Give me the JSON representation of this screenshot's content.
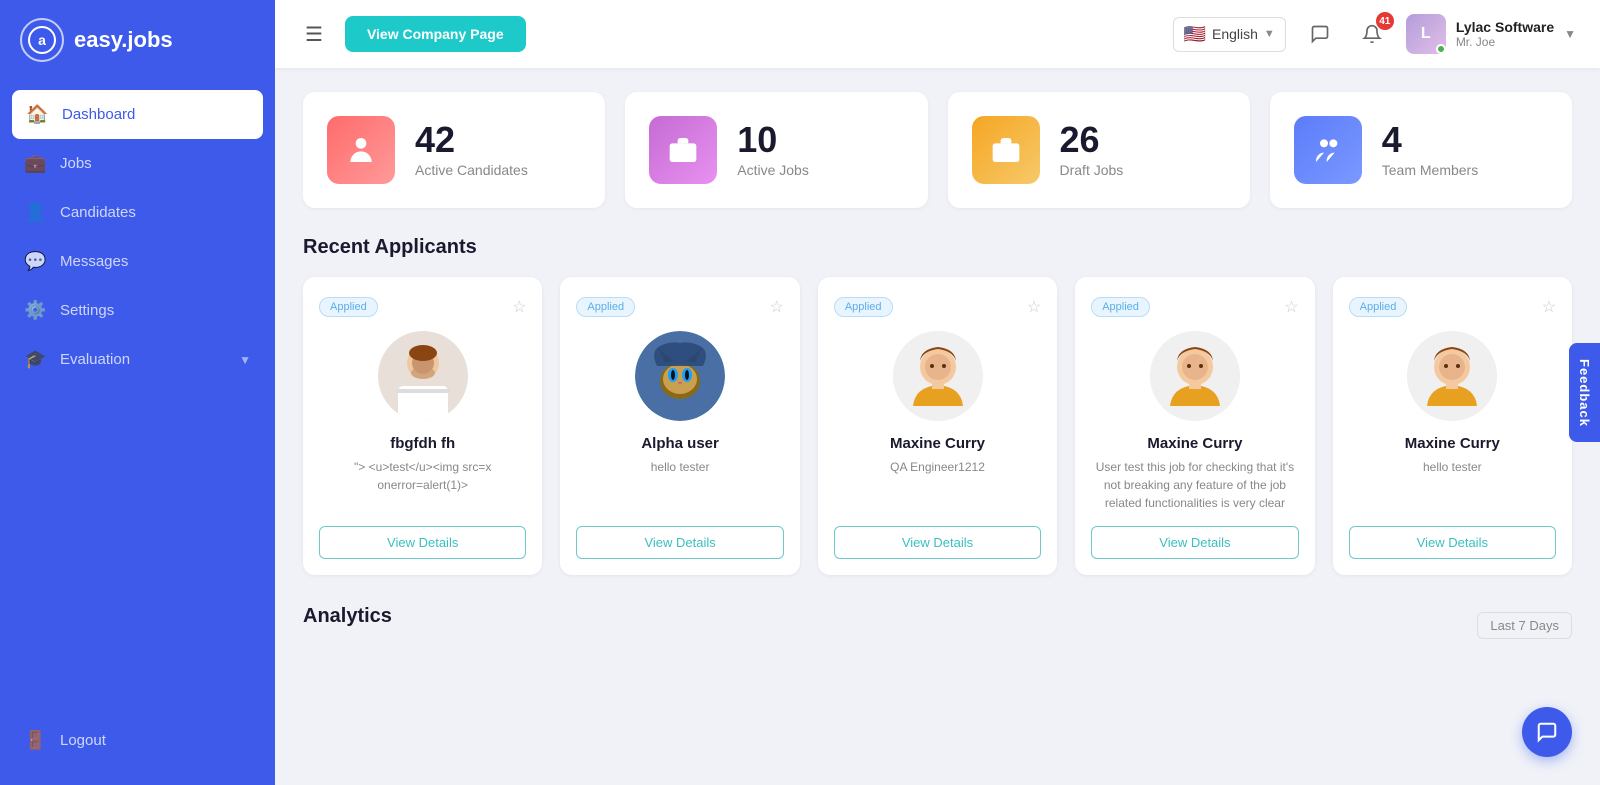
{
  "app": {
    "name": "easy.jobs",
    "logo_letter": "a"
  },
  "sidebar": {
    "items": [
      {
        "id": "dashboard",
        "label": "Dashboard",
        "icon": "🏠",
        "active": true
      },
      {
        "id": "jobs",
        "label": "Jobs",
        "icon": "💼",
        "active": false
      },
      {
        "id": "candidates",
        "label": "Candidates",
        "icon": "👤",
        "active": false
      },
      {
        "id": "messages",
        "label": "Messages",
        "icon": "💬",
        "active": false
      },
      {
        "id": "settings",
        "label": "Settings",
        "icon": "⚙️",
        "active": false
      },
      {
        "id": "evaluation",
        "label": "Evaluation",
        "icon": "🎓",
        "active": false,
        "hasArrow": true
      }
    ],
    "logout": "Logout"
  },
  "topbar": {
    "view_company_btn": "View Company Page",
    "language": "English",
    "notification_count": "41",
    "user_name": "Lylac Software",
    "user_role": "Mr. Joe"
  },
  "stats": [
    {
      "id": "candidates",
      "number": "42",
      "label": "Active Candidates",
      "icon": "👤",
      "icon_class": "stat-icon-candidates"
    },
    {
      "id": "active-jobs",
      "number": "10",
      "label": "Active Jobs",
      "icon": "💼",
      "icon_class": "stat-icon-jobs"
    },
    {
      "id": "draft-jobs",
      "number": "26",
      "label": "Draft Jobs",
      "icon": "💼",
      "icon_class": "stat-icon-draft"
    },
    {
      "id": "team",
      "number": "4",
      "label": "Team Members",
      "icon": "👥",
      "icon_class": "stat-icon-team"
    }
  ],
  "recent_applicants": {
    "title": "Recent Applicants",
    "cards": [
      {
        "id": "card1",
        "badge": "Applied",
        "name": "fbgfdh fh",
        "desc": "\"> <u>test</u><img src=x onerror=alert(1)>",
        "avatar_type": "photo",
        "avatar_url": ""
      },
      {
        "id": "card2",
        "badge": "Applied",
        "name": "Alpha user",
        "desc": "hello tester",
        "avatar_type": "cat",
        "avatar_url": ""
      },
      {
        "id": "card3",
        "badge": "Applied",
        "name": "Maxine Curry",
        "desc": "QA Engineer1212",
        "avatar_type": "person",
        "avatar_url": ""
      },
      {
        "id": "card4",
        "badge": "Applied",
        "name": "Maxine Curry",
        "desc": "User test this job for checking that it's not breaking any feature of the job related functionalities is very clear",
        "avatar_type": "person",
        "avatar_url": ""
      },
      {
        "id": "card5",
        "badge": "Applied",
        "name": "Maxine Curry",
        "desc": "hello tester",
        "avatar_type": "person",
        "avatar_url": ""
      }
    ],
    "view_details_label": "View Details"
  },
  "analytics": {
    "title": "Analytics",
    "period": "Last 7 Days"
  },
  "feedback_label": "Feedback"
}
